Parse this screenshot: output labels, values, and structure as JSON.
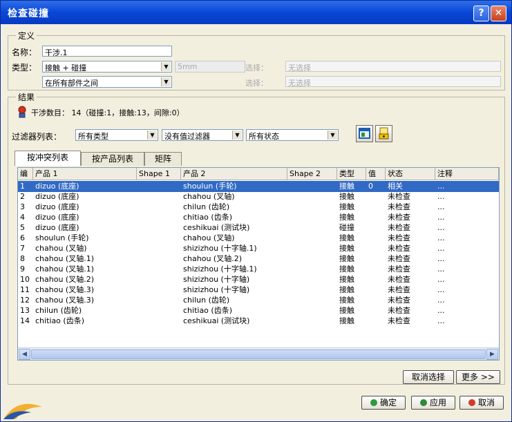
{
  "window": {
    "title": "检查碰撞"
  },
  "definition": {
    "group_title": "定义",
    "name_label": "名称：",
    "name_value": "干涉.1",
    "type_label": "类型：",
    "type_value": "接触 + 碰撞",
    "scope_value": "在所有部件之间",
    "distance_value": "5mm",
    "selection_label_1": "选择：",
    "selection_value_1": "无选择",
    "selection_label_2": "选择：",
    "selection_value_2": "无选择"
  },
  "results": {
    "group_title": "结果",
    "summary": "干涉数目： 14（碰撞:1，接触:13，间隙:0）",
    "filter_label": "过滤器列表：",
    "filter_type": "所有类型",
    "filter_value": "没有值过滤器",
    "filter_status": "所有状态",
    "tabs": [
      "按冲突列表",
      "按产品列表",
      "矩阵"
    ],
    "columns": [
      "编",
      "产品 1",
      "Shape 1",
      "产品 2",
      "Shape 2",
      "类型",
      "值",
      "状态",
      "注释"
    ],
    "rows": [
      {
        "num": "1",
        "p1": "dizuo (底座)",
        "s1": "",
        "p2": "shoulun (手轮)",
        "s2": "",
        "type": "接触",
        "val": "0",
        "status": "相关",
        "note": "..."
      },
      {
        "num": "2",
        "p1": "dizuo (底座)",
        "s1": "",
        "p2": "chahou (叉轴)",
        "s2": "",
        "type": "接触",
        "val": "",
        "status": "未检查",
        "note": "..."
      },
      {
        "num": "3",
        "p1": "dizuo (底座)",
        "s1": "",
        "p2": "chilun (齿轮)",
        "s2": "",
        "type": "接触",
        "val": "",
        "status": "未检查",
        "note": "..."
      },
      {
        "num": "4",
        "p1": "dizuo (底座)",
        "s1": "",
        "p2": "chitiao (齿条)",
        "s2": "",
        "type": "接触",
        "val": "",
        "status": "未检查",
        "note": "..."
      },
      {
        "num": "5",
        "p1": "dizuo (底座)",
        "s1": "",
        "p2": "ceshikuai (测试块)",
        "s2": "",
        "type": "碰撞",
        "val": "",
        "status": "未检查",
        "note": "..."
      },
      {
        "num": "6",
        "p1": "shoulun (手轮)",
        "s1": "",
        "p2": "chahou (叉轴)",
        "s2": "",
        "type": "接触",
        "val": "",
        "status": "未检查",
        "note": "..."
      },
      {
        "num": "7",
        "p1": "chahou (叉轴)",
        "s1": "",
        "p2": "shizizhou (十字轴.1)",
        "s2": "",
        "type": "接触",
        "val": "",
        "status": "未检查",
        "note": "..."
      },
      {
        "num": "8",
        "p1": "chahou (叉轴.1)",
        "s1": "",
        "p2": "chahou (叉轴.2)",
        "s2": "",
        "type": "接触",
        "val": "",
        "status": "未检查",
        "note": "..."
      },
      {
        "num": "9",
        "p1": "chahou (叉轴.1)",
        "s1": "",
        "p2": "shizizhou (十字轴.1)",
        "s2": "",
        "type": "接触",
        "val": "",
        "status": "未检查",
        "note": "..."
      },
      {
        "num": "10",
        "p1": "chahou (叉轴.2)",
        "s1": "",
        "p2": "shizizhou (十字轴)",
        "s2": "",
        "type": "接触",
        "val": "",
        "status": "未检查",
        "note": "..."
      },
      {
        "num": "11",
        "p1": "chahou (叉轴.3)",
        "s1": "",
        "p2": "shizizhou (十字轴)",
        "s2": "",
        "type": "接触",
        "val": "",
        "status": "未检查",
        "note": "..."
      },
      {
        "num": "12",
        "p1": "chahou (叉轴.3)",
        "s1": "",
        "p2": "chilun (齿轮)",
        "s2": "",
        "type": "接触",
        "val": "",
        "status": "未检查",
        "note": "..."
      },
      {
        "num": "13",
        "p1": "chilun (齿轮)",
        "s1": "",
        "p2": "chitiao (齿条)",
        "s2": "",
        "type": "接触",
        "val": "",
        "status": "未检查",
        "note": "..."
      },
      {
        "num": "14",
        "p1": "chitiao (齿条)",
        "s1": "",
        "p2": "ceshikuai (测试块)",
        "s2": "",
        "type": "接触",
        "val": "",
        "status": "未检查",
        "note": "..."
      }
    ]
  },
  "buttons": {
    "cancel_selection": "取消选择",
    "more": "更多 >>",
    "ok": "确定",
    "apply": "应用",
    "cancel": "取消"
  },
  "colors": {
    "titlebar": "#0a46d6",
    "selected_row": "#316ac5",
    "ok_dot": "#2e9a3c",
    "apply_dot": "#2e8a3c",
    "cancel_dot": "#d23a2a"
  }
}
